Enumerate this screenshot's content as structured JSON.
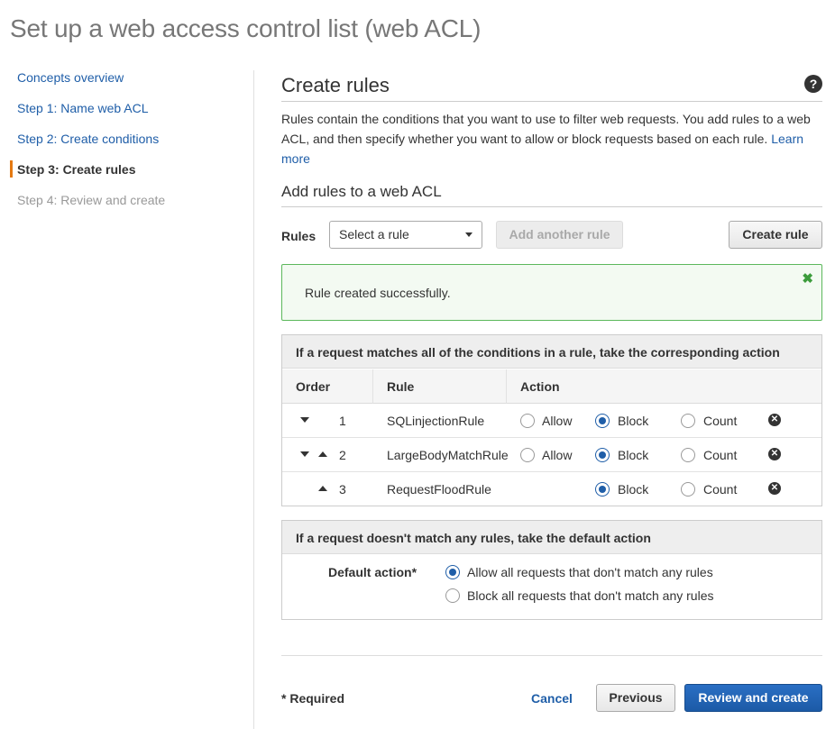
{
  "page_title": "Set up a web access control list (web ACL)",
  "nav": {
    "items": [
      {
        "label": "Concepts overview",
        "state": "link"
      },
      {
        "label": "Step 1: Name web ACL",
        "state": "link"
      },
      {
        "label": "Step 2: Create conditions",
        "state": "link"
      },
      {
        "label": "Step 3: Create rules",
        "state": "active"
      },
      {
        "label": "Step 4: Review and create",
        "state": "disabled"
      }
    ]
  },
  "main": {
    "heading": "Create rules",
    "help_icon": "question-circle-icon",
    "description": "Rules contain the conditions that you want to use to filter web requests. You add rules to a web ACL, and then specify whether you want to allow or block requests based on each rule.",
    "learn_more": "Learn more",
    "subheading": "Add rules to a web ACL",
    "rules_label": "Rules",
    "rule_select": {
      "value": "Select a rule"
    },
    "add_another_rule": "Add another rule",
    "create_rule": "Create rule",
    "alert": {
      "text": "Rule created successfully.",
      "close_icon": "close-x-icon"
    },
    "rules_table": {
      "caption": "If a request matches all of the conditions in a rule, take the corresponding action",
      "columns": [
        "Order",
        "Rule",
        "Action"
      ],
      "action_labels": {
        "allow": "Allow",
        "block": "Block",
        "count": "Count"
      },
      "rows": [
        {
          "order": "1",
          "rule": "SQLinjectionRule",
          "selected": "Block",
          "has_allow": true
        },
        {
          "order": "2",
          "rule": "LargeBodyMatchRule",
          "selected": "Block",
          "has_allow": true
        },
        {
          "order": "3",
          "rule": "RequestFloodRule",
          "selected": "Block",
          "has_allow": false
        }
      ]
    },
    "default_panel": {
      "caption": "If a request doesn't match any rules, take the default action",
      "label": "Default action*",
      "options": [
        {
          "label": "Allow all requests that don't match any rules",
          "selected": true
        },
        {
          "label": "Block all requests that don't match any rules",
          "selected": false
        }
      ]
    },
    "footer": {
      "required": "* Required",
      "cancel": "Cancel",
      "previous": "Previous",
      "review": "Review and create"
    }
  },
  "colors": {
    "link": "#1f5ea8",
    "accent": "#e47911",
    "success": "#5cb85c",
    "primary": "#1f5ea8"
  }
}
